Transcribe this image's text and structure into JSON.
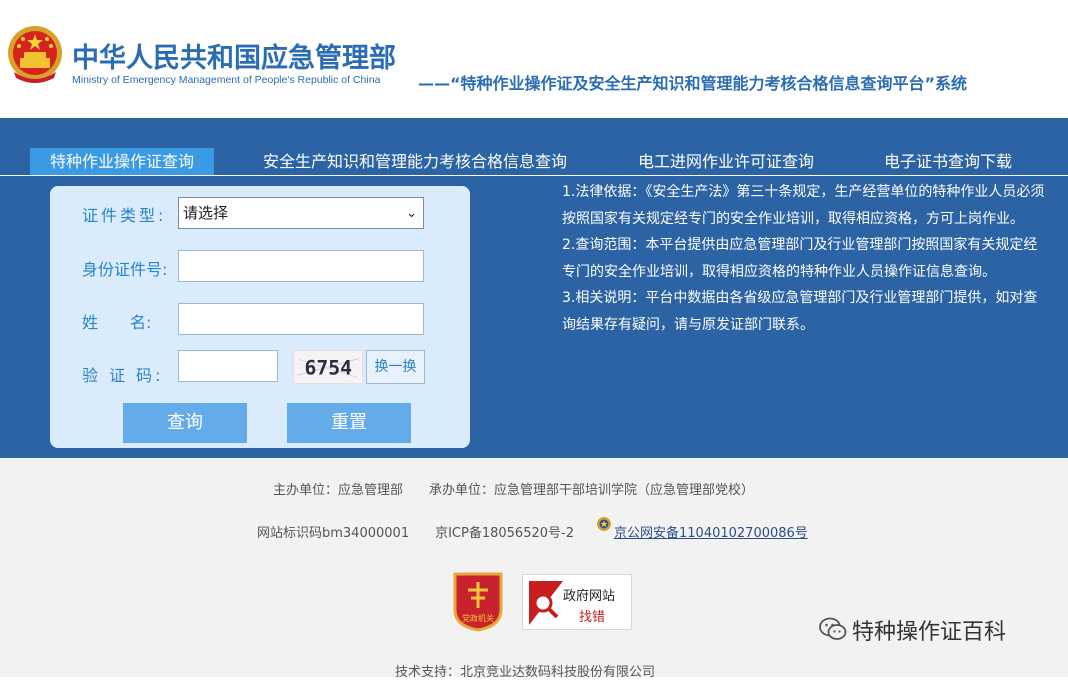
{
  "header": {
    "ministry_cn": "中华人民共和国应急管理部",
    "ministry_en": "Ministry of Emergency Management of People's Republic of China",
    "system_title": "——“特种作业操作证及安全生产知识和管理能力考核合格信息查询平台”系统"
  },
  "tabs": [
    {
      "label": "特种作业操作证查询",
      "active": true
    },
    {
      "label": "安全生产知识和管理能力考核合格信息查询",
      "active": false
    },
    {
      "label": "电工进网作业许可证查询",
      "active": false
    },
    {
      "label": "电子证书查询下载",
      "active": false
    }
  ],
  "form": {
    "cert_type_label": "证件类型:",
    "cert_type_value": "请选择",
    "id_label": "身份证件号:",
    "name_label": "姓　　名:",
    "captcha_label": "验 证 码:",
    "captcha_text": "6754",
    "swap_label": "换一换",
    "query_label": "查询",
    "reset_label": "重置"
  },
  "notes": [
    "1.法律依据：《安全生产法》第三十条规定，生产经营单位的特种作业人员必须按照国家有关规定经专门的安全作业培训，取得相应资格，方可上岗作业。",
    "2.查询范围：本平台提供由应急管理部门及行业管理部门按照国家有关规定经专门的安全作业培训，取得相应资格的特种作业人员操作证信息查询。",
    "3.相关说明：平台中数据由各省级应急管理部门及行业管理部门提供，如对查询结果存有疑问，请与原发证部门联系。"
  ],
  "footer": {
    "sponsor": "主办单位：应急管理部　　承办单位：应急管理部干部培训学院（应急管理部党校）",
    "site_code": "网站标识码bm34000001　　京ICP备18056520号-2",
    "police_record": "京公网安备11040102700086号",
    "party_badge_text": "党政机关",
    "gov_badge_line1": "政府网站",
    "gov_badge_line2": "找错",
    "tech_support": "技术支持：北京竞业达数码科技股份有限公司"
  },
  "watermark": {
    "text": "特种操作证百科",
    "icon": "wechat-icon"
  },
  "colors": {
    "brand_blue": "#2b6db3",
    "band_blue": "#2b63a4",
    "active_tab": "#3a9ae4",
    "form_bg": "#daecfb",
    "button_blue": "#63abe9",
    "footer_bg": "#f2f2f2"
  }
}
